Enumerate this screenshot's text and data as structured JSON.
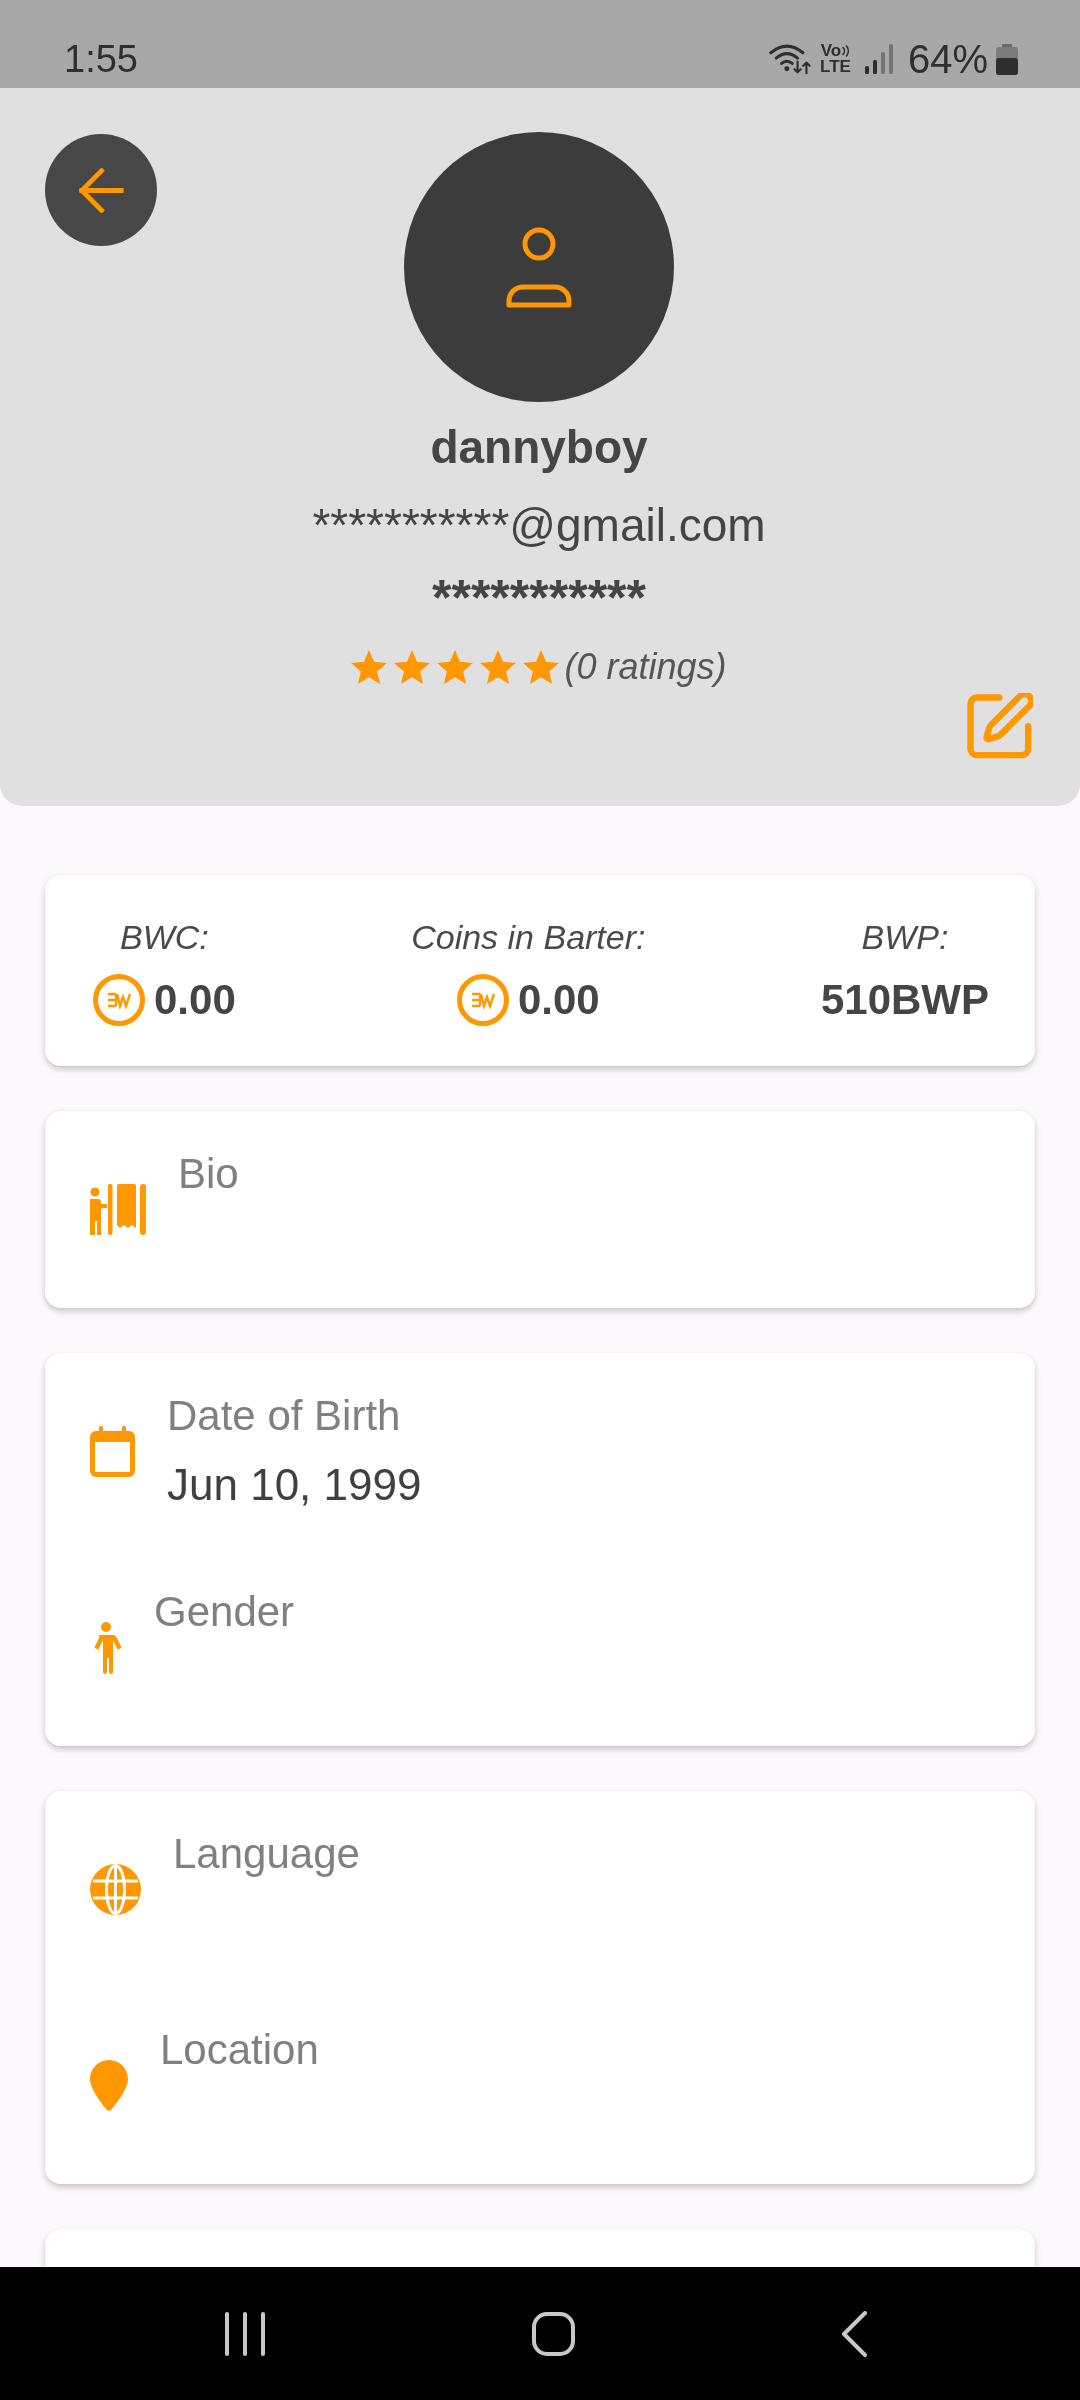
{
  "status_bar": {
    "time": "1:55",
    "network": {
      "top": "Vo",
      "bottom": "LTE"
    },
    "battery_text": "64%"
  },
  "header": {
    "username": "dannyboy",
    "email": "***********@gmail.com",
    "password": "***********",
    "rating": {
      "stars": 5,
      "count": "(0 ratings)"
    }
  },
  "balances": [
    {
      "kind": "coin",
      "label": "BWC:",
      "value": "0.00"
    },
    {
      "kind": "coin",
      "label": "Coins in Barter:",
      "value": "0.00"
    },
    {
      "kind": "plain",
      "label": "BWP:",
      "value": "510BWP"
    }
  ],
  "sections": [
    {
      "fields": [
        {
          "kind": "bio",
          "label": "Bio"
        }
      ]
    },
    {
      "fields": [
        {
          "kind": "birth_date",
          "label": "Date of Birth",
          "value": "Jun 10, 1999"
        },
        {
          "kind": "gender",
          "label": "Gender"
        }
      ]
    },
    {
      "fields": [
        {
          "kind": "language",
          "label": "Language"
        },
        {
          "kind": "location",
          "label": "Location"
        }
      ]
    }
  ]
}
